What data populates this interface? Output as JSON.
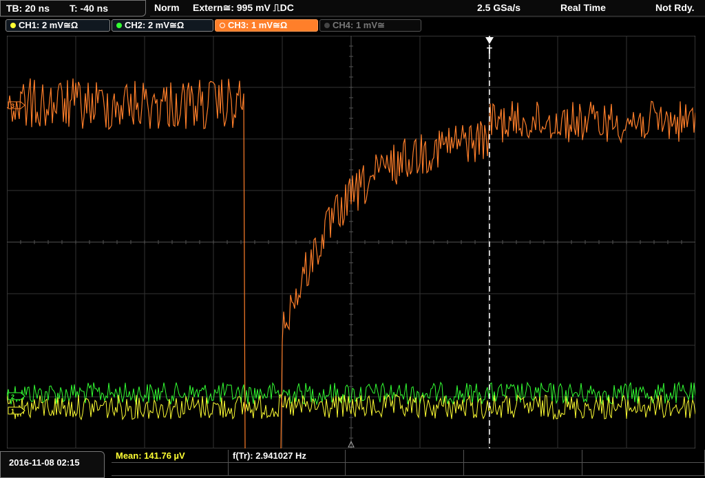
{
  "timebase": {
    "tb": "TB: 20 ns",
    "t": "T: -40 ns"
  },
  "status": {
    "mode": "Norm",
    "trigger": "Extern≅: 995 mV ⎍DC",
    "sample_rate": "2.5 GSa/s",
    "acq": "Real Time",
    "state": "Not Rdy."
  },
  "channels": [
    {
      "label": "CH1: 2 mV≅Ω",
      "color": "#ffff33"
    },
    {
      "label": "CH2: 2 mV≅Ω",
      "color": "#33ff33"
    },
    {
      "label": "CH3: 1 mV≅Ω",
      "color": "#ff7f2a"
    },
    {
      "label": "CH4: 1 mV≅",
      "color": "#555555"
    }
  ],
  "markers": {
    "ch3": "3",
    "ch2": "2",
    "ch1": "1",
    "trigger": "T"
  },
  "timestamp": "2016-11-08 02:15",
  "measurements": {
    "mean": "Mean: 141.76 µV",
    "freq": "f(Tr): 2.941027 Hz"
  },
  "colors": {
    "ch3": "#ff7f2a",
    "ch2": "#33ff33",
    "ch1": "#ffff33",
    "grid": "#3a3a3a"
  }
}
